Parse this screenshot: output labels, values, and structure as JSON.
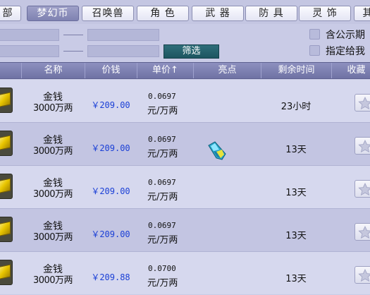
{
  "tabs": [
    {
      "label": "部"
    },
    {
      "label": "梦幻币",
      "active": true
    },
    {
      "label": "召唤兽"
    },
    {
      "label": "角 色"
    },
    {
      "label": "武 器"
    },
    {
      "label": "防 具"
    },
    {
      "label": "灵 饰"
    },
    {
      "label": "其"
    }
  ],
  "filter": {
    "button_label": "筛选",
    "option_public": "含公示期",
    "option_assign": "指定给我"
  },
  "columns": [
    "名称",
    "价钱",
    "单价↑",
    "亮点",
    "剩余时间",
    "收藏"
  ],
  "rows": [
    {
      "name": "金钱",
      "amount": "3000万两",
      "price": "￥209.00",
      "unit_value": "0.0697",
      "unit": "元/万两",
      "highlight": "",
      "time": "23小时"
    },
    {
      "name": "金钱",
      "amount": "3000万两",
      "price": "￥209.00",
      "unit_value": "0.0697",
      "unit": "元/万两",
      "highlight": "gem",
      "time": "13天"
    },
    {
      "name": "金钱",
      "amount": "3000万两",
      "price": "￥209.00",
      "unit_value": "0.0697",
      "unit": "元/万两",
      "highlight": "",
      "time": "13天"
    },
    {
      "name": "金钱",
      "amount": "3000万两",
      "price": "￥209.00",
      "unit_value": "0.0697",
      "unit": "元/万两",
      "highlight": "",
      "time": "13天"
    },
    {
      "name": "金钱",
      "amount": "3000万两",
      "price": "￥209.88",
      "unit_value": "0.0700",
      "unit": "元/万两",
      "highlight": "",
      "time": "13天"
    }
  ],
  "colors": {
    "price": "#1a3fd6",
    "header": "#7f82b1",
    "active_tab": "#8d90bf"
  },
  "icons": {
    "item": "gold-ingot-icon",
    "favorite": "star-icon",
    "highlight": "gem-icon"
  }
}
